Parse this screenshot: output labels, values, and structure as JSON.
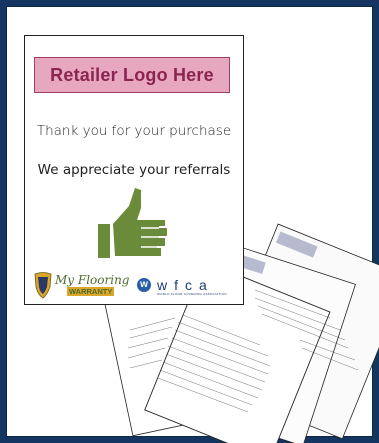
{
  "card": {
    "logo_placeholder": "Retailer Logo Here",
    "thank_you": "Thank you for your purchase",
    "appreciate": "We appreciate your referrals"
  },
  "logos": {
    "warranty_text_1": "My Flooring",
    "warranty_text_2": "WARRANTY",
    "wfca_letters": "wfca",
    "wfca_sub": "WORLD FLOOR COVERING ASSOCIATION"
  },
  "colors": {
    "background": "#14355f",
    "logo_box_fill": "#e6a7bf",
    "logo_text": "#8c2452",
    "thumb": "#6a8c3a",
    "wfca_blue": "#2a5ea8"
  }
}
